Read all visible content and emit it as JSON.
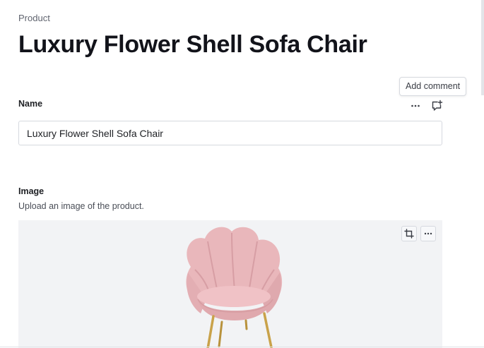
{
  "breadcrumb": "Product",
  "page_title": "Luxury Flower Shell Sofa Chair",
  "tooltip": "Add comment",
  "fields": {
    "name": {
      "label": "Name",
      "value": "Luxury Flower Shell Sofa Chair"
    },
    "image": {
      "label": "Image",
      "description": "Upload an image of the product.",
      "alt": "Pink velvet scalloped shell sofa chair"
    }
  },
  "icons": {
    "field_menu": "more-horizontal-icon",
    "add_comment": "add-comment-icon",
    "crop": "crop-icon",
    "image_menu": "more-horizontal-icon"
  },
  "colors": {
    "chair_pink": "#e8b4b8",
    "chair_legs": "#c9a24a",
    "image_bg": "#f2f3f5"
  }
}
